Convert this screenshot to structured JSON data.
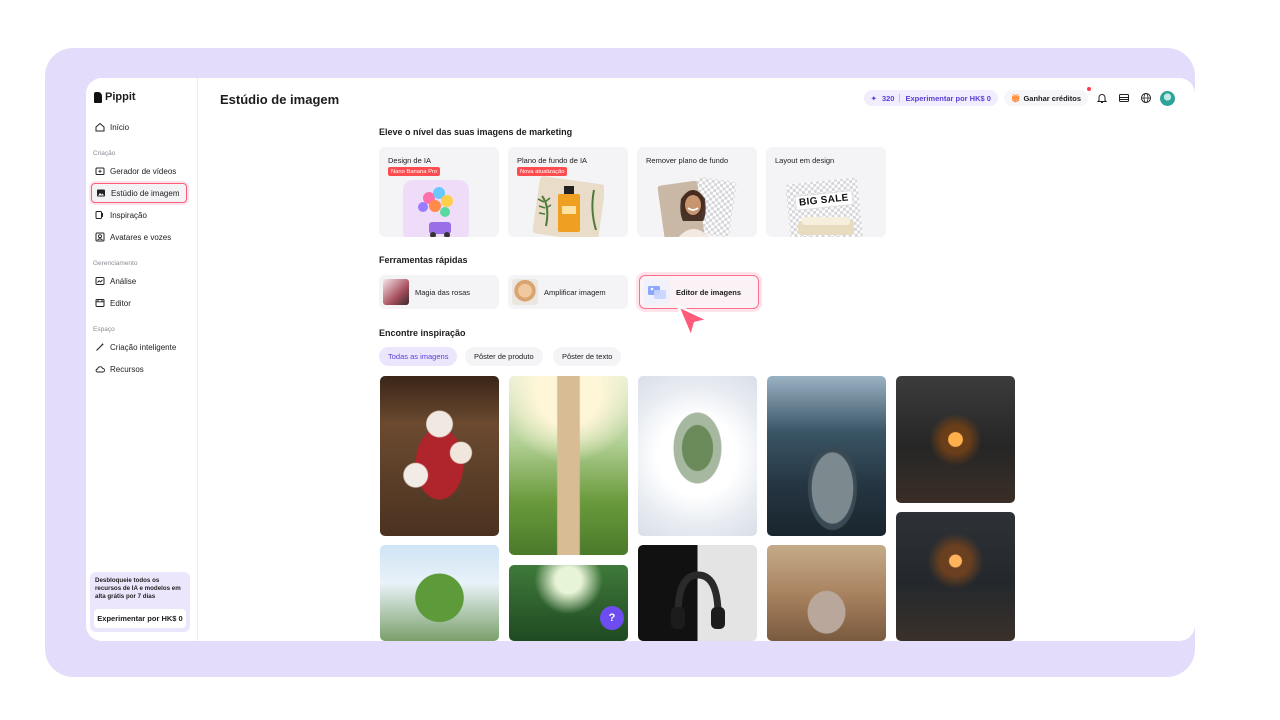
{
  "app": {
    "logo_text": "Pippit",
    "page_title": "Estúdio de imagem"
  },
  "sidebar": {
    "home": "Início",
    "section_creation": "Criação",
    "video_generator": "Gerador de vídeos",
    "image_studio": "Estúdio de imagem",
    "inspiration": "Inspiração",
    "avatars_voices": "Avatares e vozes",
    "section_management": "Gerenciamento",
    "analytics": "Análise",
    "editor": "Editor",
    "section_space": "Espaço",
    "smart_creation": "Criação inteligente",
    "resources": "Recursos",
    "promo_text": "Desbloqueie todos os recursos de IA e modelos em alta grátis por 7 dias",
    "promo_button": "Experimentar por HK$ 0"
  },
  "topbar": {
    "credits_count": "320",
    "try_label": "Experimentar por HK$ 0",
    "earn_credits": "Ganhar créditos"
  },
  "sections": {
    "marketing_title": "Eleve o nível das suas imagens de marketing",
    "quick_tools_title": "Ferramentas rápidas",
    "inspiration_title": "Encontre inspiração"
  },
  "features": [
    {
      "title": "Design de IA",
      "badge": "Nano Banana Pro"
    },
    {
      "title": "Plano de fundo de IA",
      "badge": "Nova atualização"
    },
    {
      "title": "Remover plano de fundo"
    },
    {
      "title": "Layout em design",
      "sign": "BIG SALE"
    }
  ],
  "quick_tools": [
    {
      "label": "Magia das rosas"
    },
    {
      "label": "Amplificar imagem"
    },
    {
      "label": "Editor de imagens"
    }
  ],
  "filters": [
    "Todas as imagens",
    "Pôster de produto",
    "Pôster de texto"
  ],
  "help_label": "?",
  "colors": {
    "accent": "#6d4cf0",
    "highlight": "#ff6f8c",
    "badge": "#ff4d4f",
    "frame": "#e4dcfb"
  }
}
